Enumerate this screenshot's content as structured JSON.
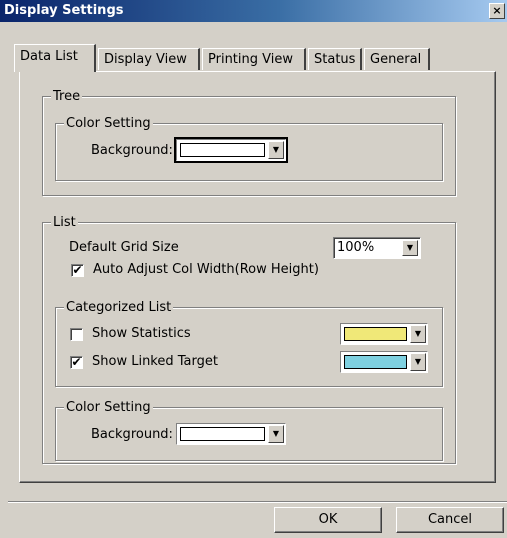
{
  "window": {
    "title": "Display Settings",
    "close_glyph": "×"
  },
  "tabs": [
    {
      "label": "Data List",
      "active": true
    },
    {
      "label": "Display View",
      "active": false
    },
    {
      "label": "Printing View",
      "active": false
    },
    {
      "label": "Status",
      "active": false
    },
    {
      "label": "General",
      "active": false
    }
  ],
  "tree": {
    "legend": "Tree",
    "color_setting": {
      "legend": "Color Setting",
      "background_label": "Background:",
      "background_color": "#ffffff"
    }
  },
  "list": {
    "legend": "List",
    "grid_size_label": "Default Grid Size",
    "grid_size_value": "100%",
    "auto_adjust_label": "Auto Adjust Col Width(Row Height)",
    "auto_adjust_checked": true,
    "categorized": {
      "legend": "Categorized List",
      "show_statistics_label": "Show Statistics",
      "show_statistics_checked": false,
      "statistics_color": "#f0e878",
      "show_linked_label": "Show Linked Target",
      "show_linked_checked": true,
      "linked_color": "#7ed0e0"
    },
    "color_setting": {
      "legend": "Color Setting",
      "background_label": "Background:",
      "background_color": "#ffffff"
    }
  },
  "buttons": {
    "ok": "OK",
    "cancel": "Cancel"
  },
  "icons": {
    "dropdown_arrow": "▼",
    "check": "✔"
  }
}
